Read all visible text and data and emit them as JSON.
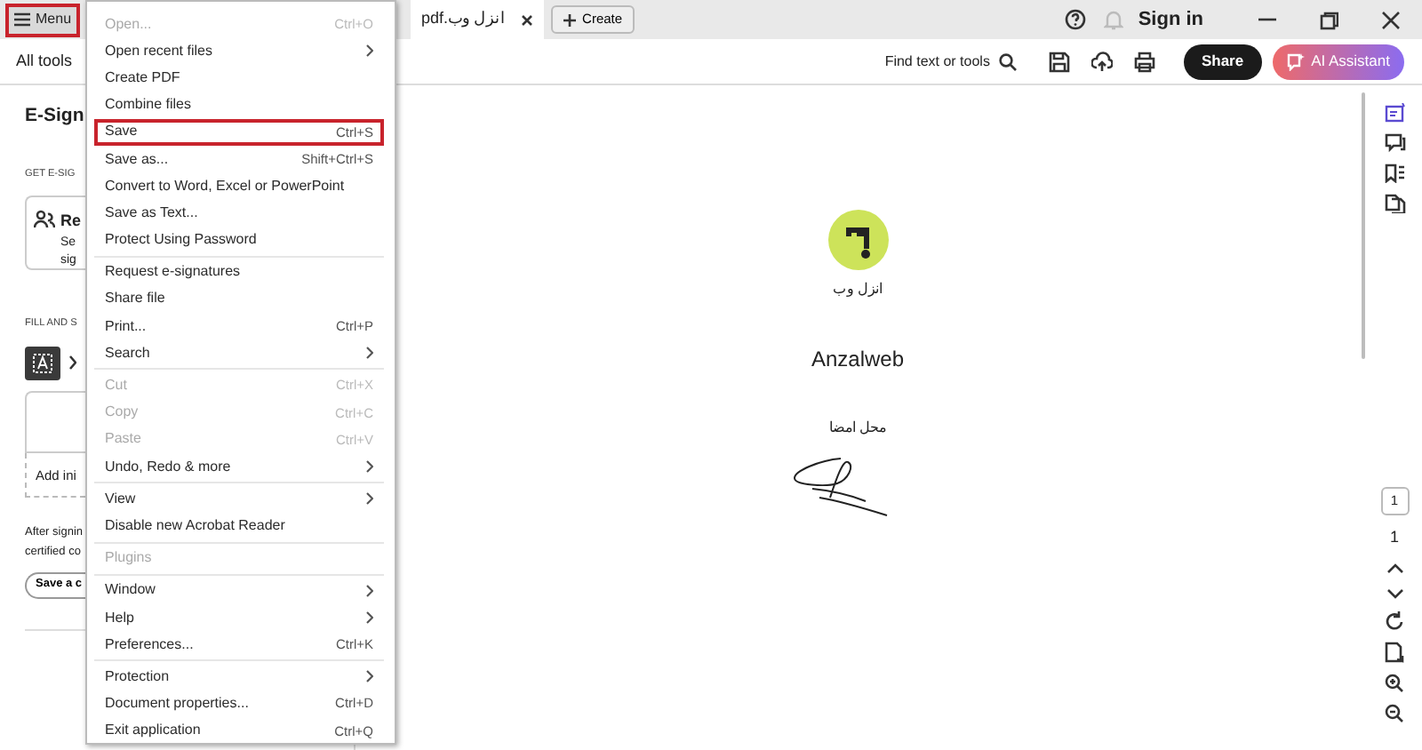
{
  "title_bar": {
    "menu_button": {
      "label": "Menu",
      "highlighted": true
    },
    "tabs": [
      {
        "label": "انزل وب.pdf",
        "selected": true
      }
    ],
    "create_button": "Create",
    "sign_in": "Sign in"
  },
  "toolbar": {
    "all_tools": "All tools",
    "search_label": "Find text or tools",
    "share_button": "Share",
    "ai_button": "AI Assistant"
  },
  "left_panel": {
    "heading": "E-Sign",
    "section_1": "GET E-SIG",
    "card_title": "Re",
    "card_lines": [
      "Se",
      "sig"
    ],
    "section_2": "FILL AND S",
    "add_initials": "Add ini",
    "note_lines": [
      "After signin",
      "certified co"
    ],
    "save_button": "Save a c"
  },
  "menu": {
    "groups": [
      [
        {
          "label": "Open...",
          "shortcut": "Ctrl+O",
          "submenu": false,
          "disabled": true,
          "highlighted": false
        },
        {
          "label": "Open recent files",
          "submenu": true,
          "disabled": false,
          "highlighted": false
        },
        {
          "label": "Create PDF",
          "submenu": false,
          "disabled": false,
          "highlighted": false
        },
        {
          "label": "Combine files",
          "submenu": false,
          "disabled": false,
          "highlighted": false
        },
        {
          "label": "Save",
          "shortcut": "Ctrl+S",
          "submenu": false,
          "disabled": false,
          "highlighted": true
        },
        {
          "label": "Save as...",
          "shortcut": "Shift+Ctrl+S",
          "submenu": false,
          "disabled": false,
          "highlighted": false
        },
        {
          "label": "Convert to Word, Excel or PowerPoint",
          "submenu": false,
          "disabled": false,
          "highlighted": false
        },
        {
          "label": "Save as Text...",
          "submenu": false,
          "disabled": false,
          "highlighted": false
        },
        {
          "label": "Protect Using Password",
          "submenu": false,
          "disabled": false,
          "highlighted": false
        }
      ],
      [
        {
          "label": "Request e-signatures",
          "submenu": false,
          "disabled": false,
          "highlighted": false
        },
        {
          "label": "Share file",
          "submenu": false,
          "disabled": false,
          "highlighted": false
        },
        {
          "label": "Print...",
          "shortcut": "Ctrl+P",
          "submenu": false,
          "disabled": false,
          "highlighted": false
        },
        {
          "label": "Search",
          "submenu": true,
          "disabled": false,
          "highlighted": false
        }
      ],
      [
        {
          "label": "Cut",
          "shortcut": "Ctrl+X",
          "submenu": false,
          "disabled": true,
          "highlighted": false
        },
        {
          "label": "Copy",
          "shortcut": "Ctrl+C",
          "submenu": false,
          "disabled": true,
          "highlighted": false
        },
        {
          "label": "Paste",
          "shortcut": "Ctrl+V",
          "submenu": false,
          "disabled": true,
          "highlighted": false
        },
        {
          "label": "Undo, Redo & more",
          "submenu": true,
          "disabled": false,
          "highlighted": false
        }
      ],
      [
        {
          "label": "View",
          "submenu": true,
          "disabled": false,
          "highlighted": false
        },
        {
          "label": "Disable new Acrobat Reader",
          "submenu": false,
          "disabled": false,
          "highlighted": false
        }
      ],
      [
        {
          "label": "Plugins",
          "submenu": false,
          "disabled": true,
          "highlighted": false
        }
      ],
      [
        {
          "label": "Window",
          "submenu": true,
          "disabled": false,
          "highlighted": false
        },
        {
          "label": "Help",
          "submenu": true,
          "disabled": false,
          "highlighted": false
        },
        {
          "label": "Preferences...",
          "shortcut": "Ctrl+K",
          "submenu": false,
          "disabled": false,
          "highlighted": false
        }
      ],
      [
        {
          "label": "Protection",
          "submenu": true,
          "disabled": false,
          "highlighted": false
        },
        {
          "label": "Document properties...",
          "shortcut": "Ctrl+D",
          "submenu": false,
          "disabled": false,
          "highlighted": false
        },
        {
          "label": "Exit application",
          "shortcut": "Ctrl+Q",
          "submenu": false,
          "disabled": false,
          "highlighted": false
        }
      ]
    ]
  },
  "document": {
    "logo_caption": "انزل وب",
    "name": "Anzalweb",
    "signature_label": "محل امضا"
  },
  "right_rail": {
    "page_number": "1",
    "page_count": "1"
  }
}
